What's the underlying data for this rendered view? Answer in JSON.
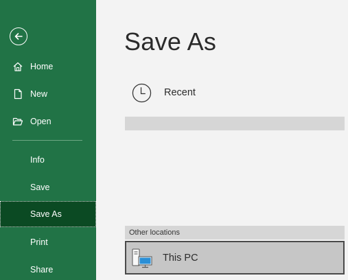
{
  "sidebar": {
    "items": [
      {
        "label": "Home",
        "icon": "home-icon"
      },
      {
        "label": "New",
        "icon": "new-document-icon"
      },
      {
        "label": "Open",
        "icon": "open-folder-icon"
      },
      {
        "label": "Info"
      },
      {
        "label": "Save"
      },
      {
        "label": "Save As",
        "selected": true
      },
      {
        "label": "Print"
      },
      {
        "label": "Share"
      }
    ]
  },
  "main": {
    "title": "Save As",
    "recent_label": "Recent",
    "other_locations_header": "Other locations",
    "locations": [
      {
        "label": "This PC",
        "icon": "this-pc-icon"
      }
    ]
  },
  "colors": {
    "sidebar_bg": "#217346",
    "sidebar_selected": "#0b4a23",
    "main_bg": "#f3f3f3"
  }
}
